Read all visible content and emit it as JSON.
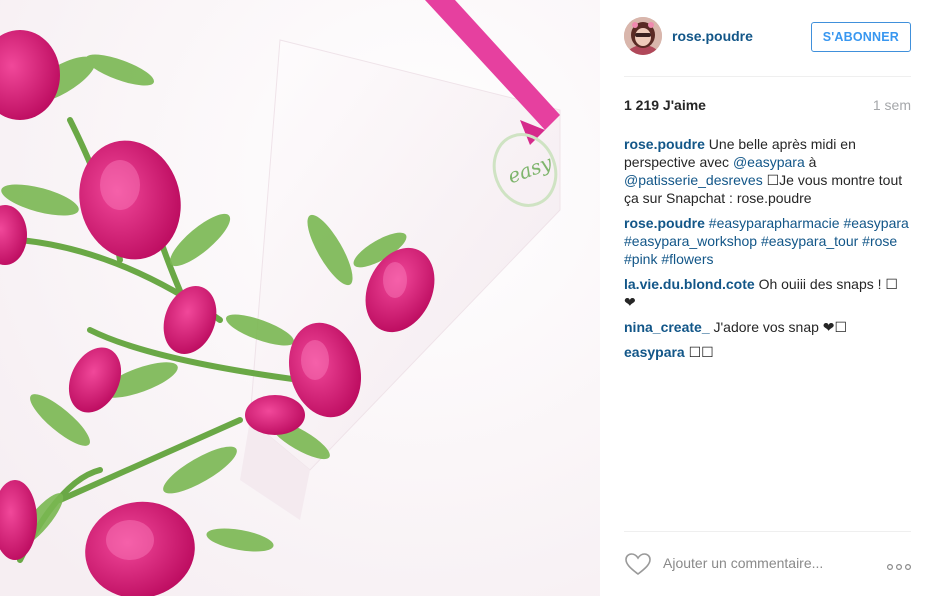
{
  "post": {
    "username": "rose.poudre",
    "follow_label": "S'ABONNER",
    "likes": "1 219 J'aime",
    "time": "1 sem",
    "photo_box_brand": "easy"
  },
  "comments": [
    {
      "author": "rose.poudre",
      "parts": [
        {
          "text": " Une belle après midi en perspective avec ",
          "link": false
        },
        {
          "text": "@easypara",
          "link": true
        },
        {
          "text": " à ",
          "link": false
        },
        {
          "text": "@patisserie_desreves",
          "link": true
        },
        {
          "text": " ☐Je vous montre tout ça sur Snapchat : rose.poudre",
          "link": false
        }
      ]
    },
    {
      "author": "rose.poudre",
      "parts": [
        {
          "text": " ",
          "link": false
        },
        {
          "text": "#easyparapharmacie",
          "link": true
        },
        {
          "text": " ",
          "link": false
        },
        {
          "text": "#easypara",
          "link": true
        },
        {
          "text": " ",
          "link": false
        },
        {
          "text": "#easypara_workshop",
          "link": true
        },
        {
          "text": " ",
          "link": false
        },
        {
          "text": "#easypara_tour",
          "link": true
        },
        {
          "text": " ",
          "link": false
        },
        {
          "text": "#rose",
          "link": true
        },
        {
          "text": " ",
          "link": false
        },
        {
          "text": "#pink",
          "link": true
        },
        {
          "text": " ",
          "link": false
        },
        {
          "text": "#flowers",
          "link": true
        }
      ]
    },
    {
      "author": "la.vie.du.blond.cote",
      "parts": [
        {
          "text": " Oh ouiii des snaps ! ☐ ❤",
          "link": false
        }
      ]
    },
    {
      "author": "nina_create_",
      "parts": [
        {
          "text": " J'adore vos snap ❤☐",
          "link": false
        }
      ]
    },
    {
      "author": "easypara",
      "parts": [
        {
          "text": " ☐☐",
          "link": false
        }
      ]
    }
  ],
  "add_comment": {
    "placeholder": "Ajouter un commentaire..."
  },
  "icons": {
    "like": "heart-outline-icon",
    "more": "more-options-icon"
  },
  "colors": {
    "link": "#125688",
    "accent": "#3897f0",
    "flower": "#e0157a"
  }
}
